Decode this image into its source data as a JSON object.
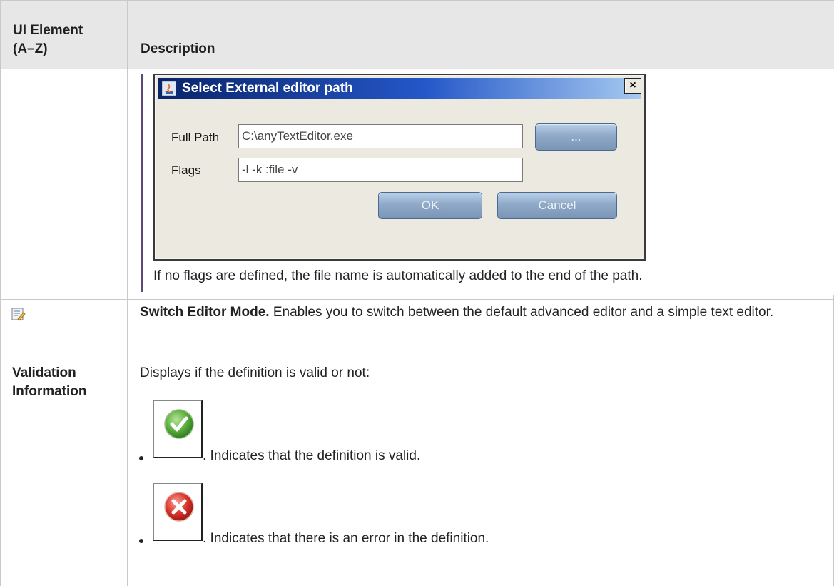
{
  "table": {
    "headers": [
      "UI Element (A–Z)",
      "Description"
    ],
    "header_el_line1": "UI Element",
    "header_el_line2": "(A–Z)",
    "header_desc": "Description"
  },
  "row1": {
    "dialog": {
      "title": "Select External editor path",
      "close_glyph": "×",
      "full_path_label": "Full Path",
      "full_path_value": "C:\\anyTextEditor.exe",
      "browse_label": "...",
      "flags_label": "Flags",
      "flags_value": "-l -k :file -v",
      "ok_label": "OK",
      "cancel_label": "Cancel"
    },
    "note": "If no flags are defined, the file name is automatically added to the end of the path."
  },
  "row2": {
    "icon": "switch-editor-icon",
    "title": "Switch Editor Mode.",
    "text": " Enables you to switch between the default advanced editor and a simple text editor."
  },
  "row3": {
    "element_line1": "Validation",
    "element_line2": "Information",
    "intro": "Displays if the definition is valid or not:",
    "bullets": [
      {
        "icon": "valid-check-icon",
        "text": ". Indicates that the definition is valid."
      },
      {
        "icon": "error-x-icon",
        "text": ". Indicates that there is an error in the definition."
      }
    ]
  },
  "colors": {
    "callout_bar": "#5c4a75",
    "header_bg": "#e7e7e7",
    "valid_green": "#5aae3c",
    "error_red": "#d9342b"
  }
}
